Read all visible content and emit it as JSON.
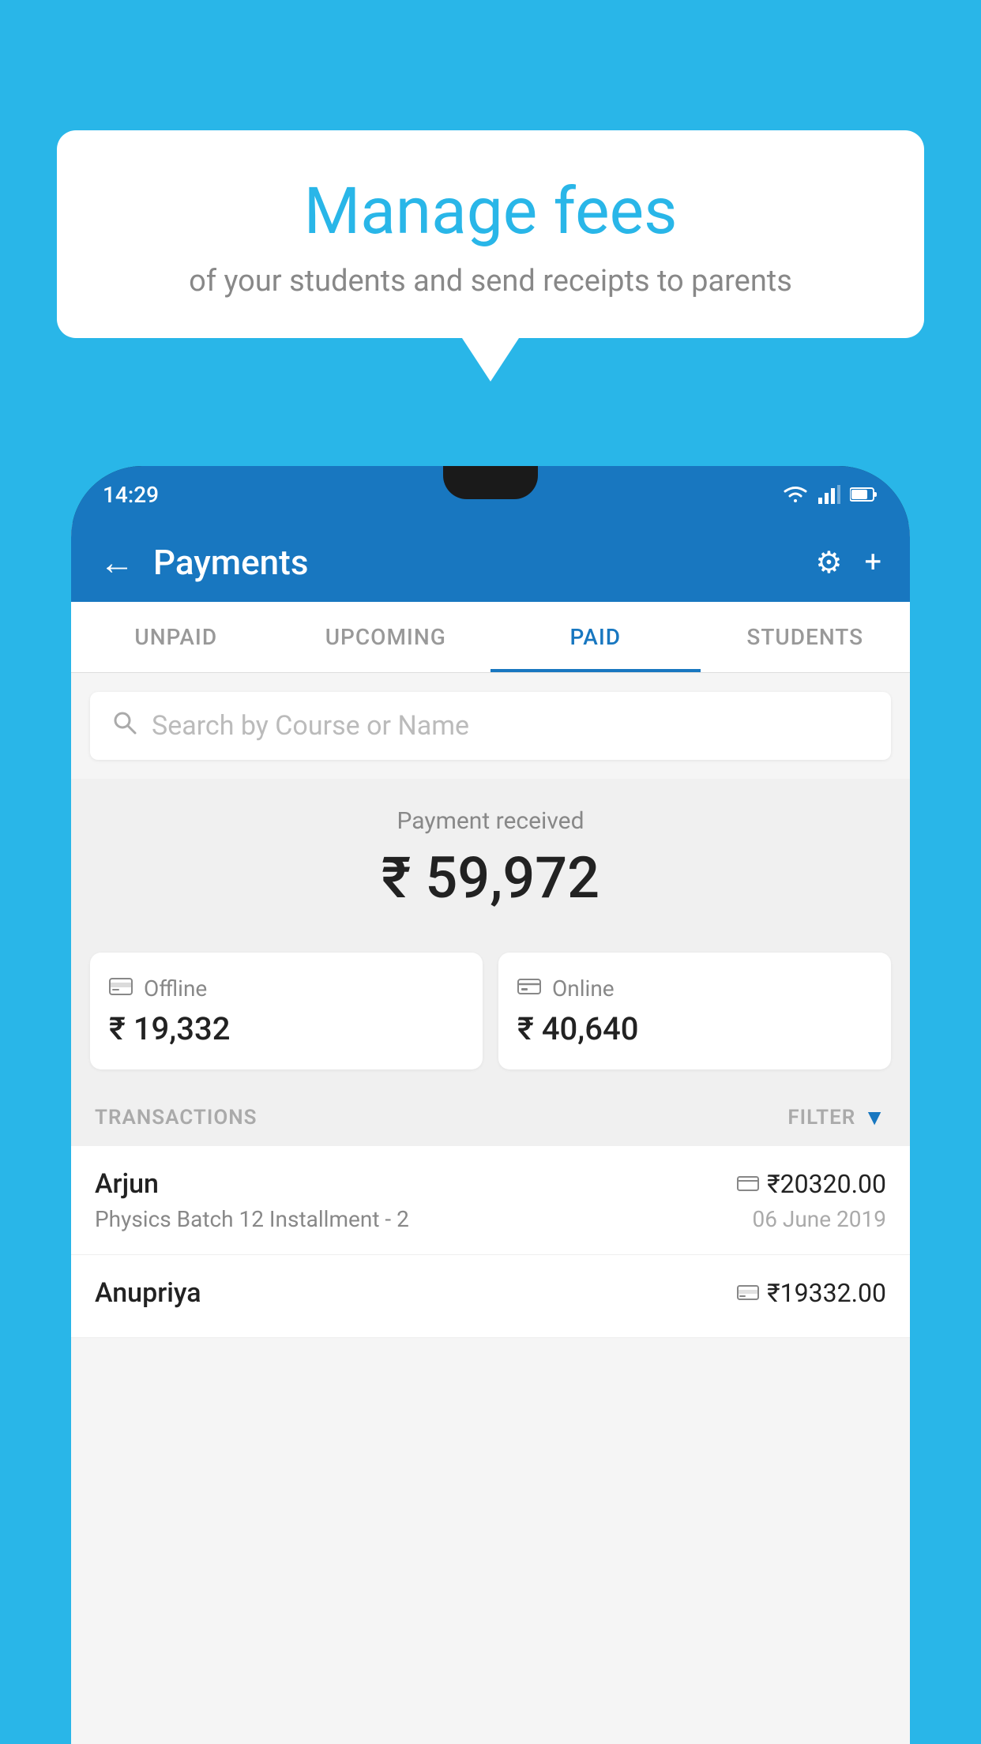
{
  "background_color": "#29b6e8",
  "bubble": {
    "title": "Manage fees",
    "subtitle": "of your students and send receipts to parents"
  },
  "phone": {
    "status_bar": {
      "time": "14:29"
    },
    "top_bar": {
      "title": "Payments",
      "back_label": "←",
      "settings_icon": "⚙",
      "add_icon": "+"
    },
    "tabs": [
      {
        "label": "UNPAID",
        "active": false
      },
      {
        "label": "UPCOMING",
        "active": false
      },
      {
        "label": "PAID",
        "active": true
      },
      {
        "label": "STUDENTS",
        "active": false
      }
    ],
    "search": {
      "placeholder": "Search by Course or Name"
    },
    "payment_summary": {
      "label": "Payment received",
      "amount": "₹ 59,972"
    },
    "payment_cards": [
      {
        "icon": "💳",
        "label": "Offline",
        "amount": "₹ 19,332"
      },
      {
        "icon": "💳",
        "label": "Online",
        "amount": "₹ 40,640"
      }
    ],
    "transactions_label": "TRANSACTIONS",
    "filter_label": "FILTER",
    "transactions": [
      {
        "name": "Arjun",
        "amount": "₹20320.00",
        "course": "Physics Batch 12 Installment - 2",
        "date": "06 June 2019",
        "payment_type": "online"
      },
      {
        "name": "Anupriya",
        "amount": "₹19332.00",
        "course": "",
        "date": "",
        "payment_type": "offline"
      }
    ]
  }
}
